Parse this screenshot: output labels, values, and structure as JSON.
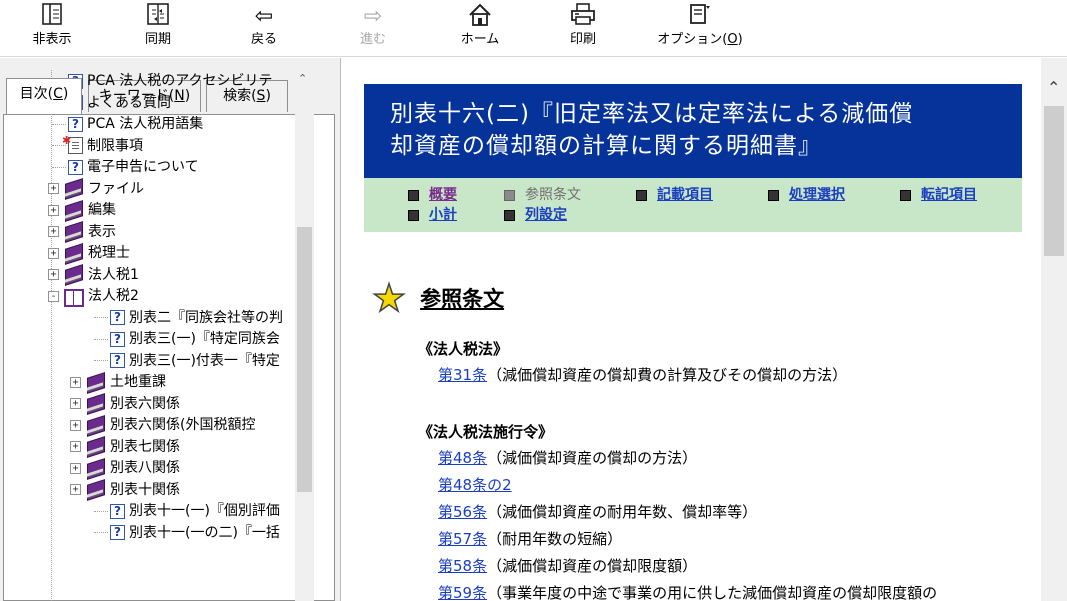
{
  "toolbar": {
    "hide": "非表示",
    "sync": "同期",
    "back": "戻る",
    "forward": "進む",
    "home": "ホーム",
    "print": "印刷",
    "options": "オプション(",
    "options_key": "O",
    "options_close": ")"
  },
  "tabs": {
    "contents": "目次(",
    "contents_key": "C",
    "keyword": "キーワード(",
    "keyword_key": "N",
    "search": "検索(",
    "search_key": "S",
    "close": ")"
  },
  "tree": [
    {
      "label": "PCA 法人税のアクセシビリテ",
      "icon": "question-page"
    },
    {
      "label": "よくある質問",
      "icon": "question-page"
    },
    {
      "label": "PCA 法人税用語集",
      "icon": "question-page"
    },
    {
      "label": "制限事項",
      "icon": "new-document"
    },
    {
      "label": "電子申告について",
      "icon": "question-page"
    },
    {
      "label": "ファイル",
      "icon": "book",
      "expander": "+"
    },
    {
      "label": "編集",
      "icon": "book",
      "expander": "+"
    },
    {
      "label": "表示",
      "icon": "book",
      "expander": "+"
    },
    {
      "label": "税理士",
      "icon": "book",
      "expander": "+"
    },
    {
      "label": "法人税1",
      "icon": "book",
      "expander": "+"
    },
    {
      "label": "法人税2",
      "icon": "open-book",
      "expander": "-"
    },
    {
      "label": "別表二『同族会社等の判",
      "icon": "question-page"
    },
    {
      "label": "別表三(一)『特定同族会",
      "icon": "question-page"
    },
    {
      "label": "別表三(一)付表一『特定",
      "icon": "question-page"
    },
    {
      "label": "土地重課",
      "icon": "book",
      "expander": "+"
    },
    {
      "label": "別表六関係",
      "icon": "book",
      "expander": "+"
    },
    {
      "label": "別表六関係(外国税額控",
      "icon": "book",
      "expander": "+"
    },
    {
      "label": "別表七関係",
      "icon": "book",
      "expander": "+"
    },
    {
      "label": "別表八関係",
      "icon": "book",
      "expander": "+"
    },
    {
      "label": "別表十関係",
      "icon": "book",
      "expander": "+"
    },
    {
      "label": "別表十一(一)『個別評価",
      "icon": "question-page"
    },
    {
      "label": "別表十一(一の二)『一括",
      "icon": "question-page"
    }
  ],
  "content": {
    "title_line1": "別表十六(二)『旧定率法又は定率法による減価償",
    "title_line2": "却資産の償却額の計算に関する明細書』",
    "nav": {
      "overview": "概要",
      "reference": "参照条文",
      "entry_items": "記載項目",
      "processing": "処理選択",
      "transfer": "転記項目",
      "subtotal": "小計",
      "columns": "列設定"
    },
    "section_title": "参照条文",
    "law1": {
      "heading": "《法人税法》",
      "articles": [
        {
          "link": "第31条",
          "desc": "（減価償却資産の償却費の計算及びその償却の方法）"
        }
      ]
    },
    "law2": {
      "heading": "《法人税法施行令》",
      "articles": [
        {
          "link": "第48条",
          "desc": "（減価償却資産の償却の方法）"
        },
        {
          "link": "第48条の2",
          "desc": ""
        },
        {
          "link": "第56条",
          "desc": "（減価償却資産の耐用年数、償却率等）"
        },
        {
          "link": "第57条",
          "desc": "（耐用年数の短縮）"
        },
        {
          "link": "第58条",
          "desc": "（減価償却資産の償却限度額）"
        },
        {
          "link": "第59条",
          "desc": "（事業年度の中途で事業の用に供した減価償却資産の償却限度額の"
        }
      ]
    }
  }
}
